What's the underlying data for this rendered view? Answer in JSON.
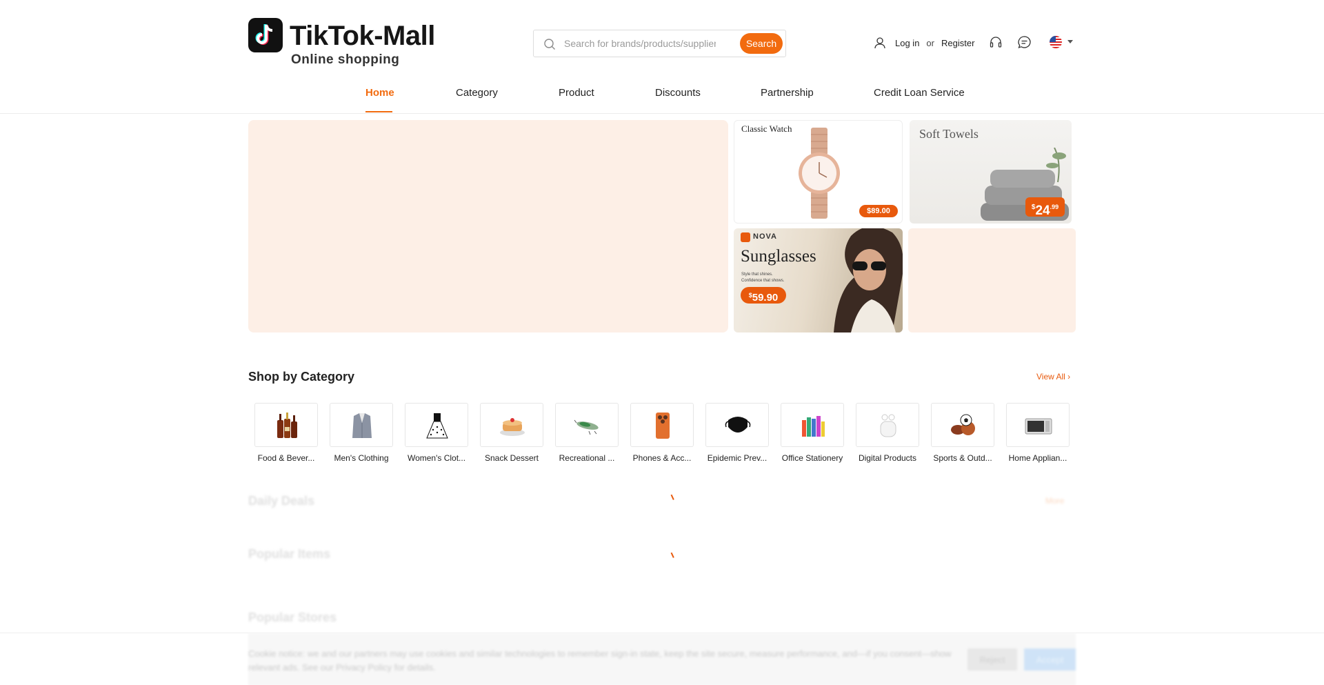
{
  "brand": {
    "title": "TikTok-Mall",
    "subtitle": "Online shopping"
  },
  "search": {
    "placeholder": "Search for brands/products/suppliers",
    "value": "",
    "button_label": "Search"
  },
  "user": {
    "login_label": "Log in",
    "or_label": "or",
    "register_label": "Register"
  },
  "header_icons": [
    "user-icon",
    "headset-icon",
    "chat-icon",
    "us-flag-icon",
    "caret-down-icon"
  ],
  "nav": {
    "active": "Home",
    "items": [
      "Home",
      "Category",
      "Product",
      "Discounts",
      "Partnership",
      "Credit Loan Service"
    ]
  },
  "promos": {
    "watch": {
      "title": "Classic Watch",
      "price": "$89.00"
    },
    "towels": {
      "title": "Soft Towels",
      "price_symbol": "$",
      "price_main": "24",
      "price_cents": ".99"
    },
    "sunglasses": {
      "brand": "NOVA",
      "title": "Sunglasses",
      "tagline_1": "Style that shines.",
      "tagline_2": "Confidence that shows.",
      "price_symbol": "$",
      "price_main": "59.90"
    }
  },
  "category_section": {
    "title": "Shop by Category",
    "view_all": "View All",
    "items": [
      {
        "label": "Food & Bever...",
        "icon": "bottles-icon"
      },
      {
        "label": "Men's Clothing",
        "icon": "suit-icon"
      },
      {
        "label": "Women's Clot...",
        "icon": "dress-icon"
      },
      {
        "label": "Snack Dessert",
        "icon": "dessert-icon"
      },
      {
        "label": "Recreational ...",
        "icon": "fishing-lure-icon"
      },
      {
        "label": "Phones & Acc...",
        "icon": "phone-icon"
      },
      {
        "label": "Epidemic Prev...",
        "icon": "mask-icon"
      },
      {
        "label": "Office Stationery",
        "icon": "stationery-icon"
      },
      {
        "label": "Digital Products",
        "icon": "earbuds-icon"
      },
      {
        "label": "Sports & Outd...",
        "icon": "balls-icon"
      },
      {
        "label": "Home Applian...",
        "icon": "microwave-icon"
      }
    ]
  },
  "loading_sections": {
    "daily_deals": "Daily Deals",
    "daily_deals_more": "More",
    "popular_items": "Popular Items",
    "popular_stores": "Popular Stores"
  },
  "cookie": {
    "text": "Cookie notice: we and our partners may use cookies and similar technologies to remember sign-in state, keep the site secure, measure performance, and—if you consent—show relevant ads. See our Privacy Policy for details.",
    "reject_label": "Reject",
    "accept_label": "Accept"
  },
  "colors": {
    "accent": "#f26b0f",
    "banner_placeholder": "#fdefe6"
  }
}
